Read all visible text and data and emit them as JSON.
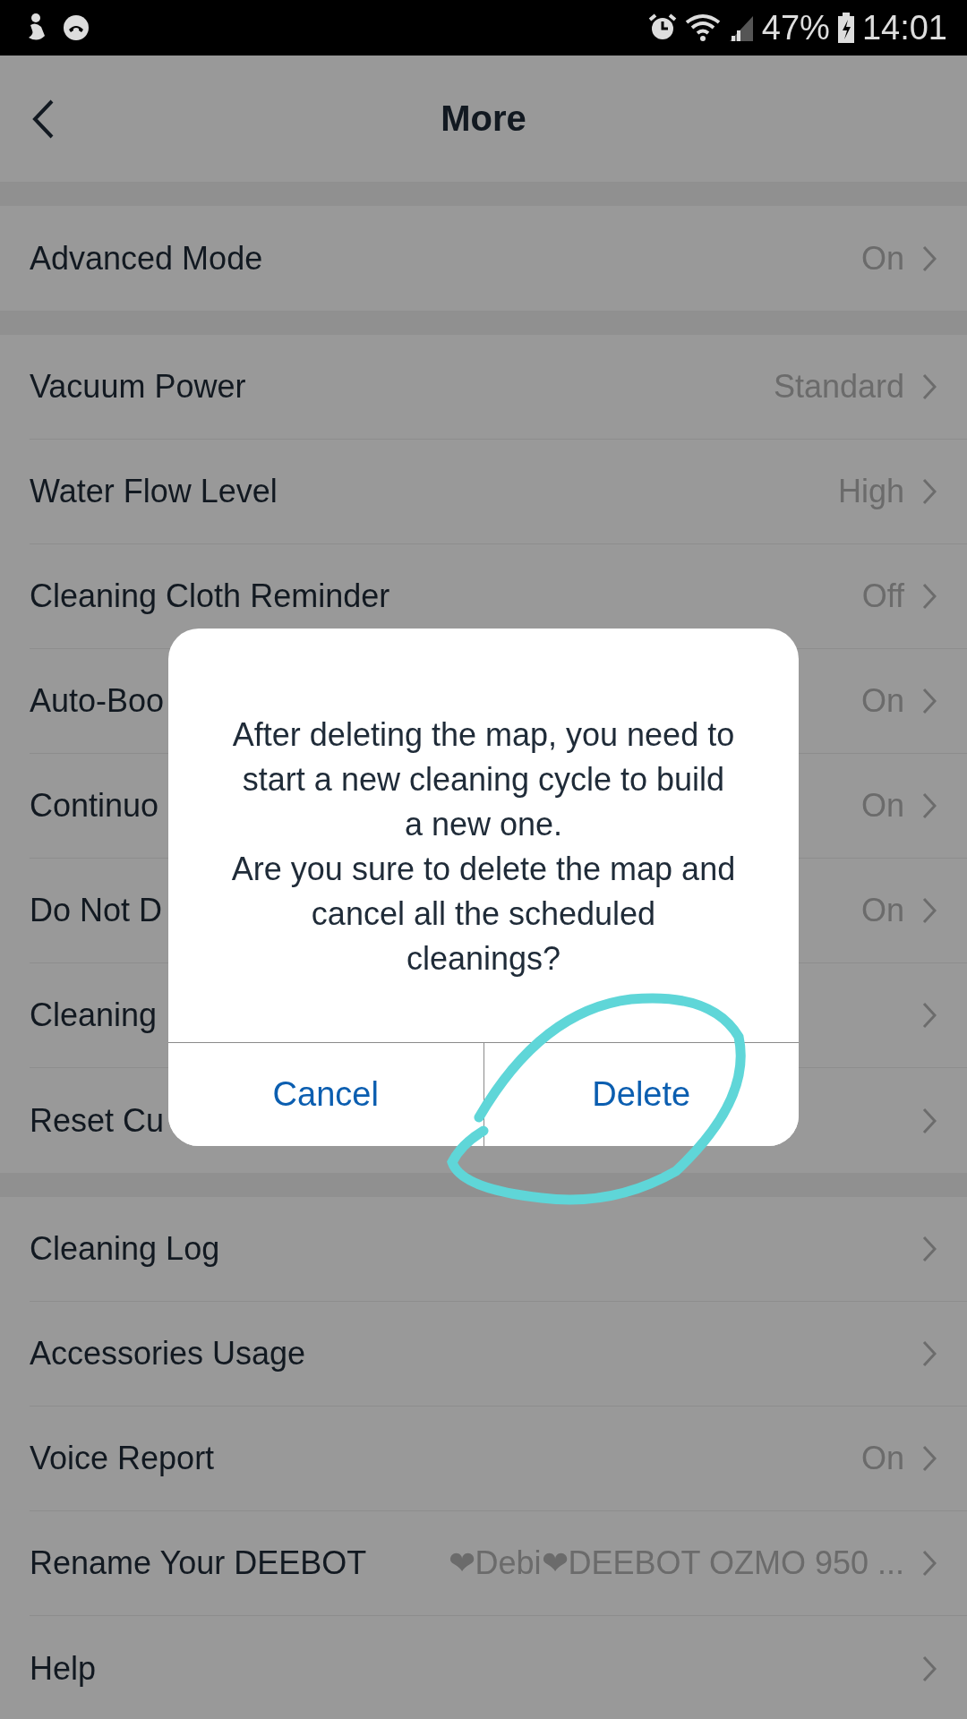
{
  "status_bar": {
    "battery": "47%",
    "time": "14:01"
  },
  "header": {
    "title": "More"
  },
  "sections": [
    {
      "rows": [
        {
          "label": "Advanced Mode",
          "value": "On"
        }
      ]
    },
    {
      "rows": [
        {
          "label": "Vacuum Power",
          "value": "Standard"
        },
        {
          "label": "Water Flow Level",
          "value": "High"
        },
        {
          "label": "Cleaning Cloth Reminder",
          "value": "Off"
        },
        {
          "label": "Auto-Boo",
          "value": "On"
        },
        {
          "label": "Continuo",
          "value": "On"
        },
        {
          "label": "Do Not D",
          "value": "On"
        },
        {
          "label": "Cleaning"
        },
        {
          "label": "Reset Cu"
        }
      ]
    },
    {
      "rows": [
        {
          "label": "Cleaning Log"
        },
        {
          "label": "Accessories Usage"
        },
        {
          "label": "Voice Report",
          "value": "On"
        },
        {
          "label": "Rename Your DEEBOT",
          "value": "❤Debi❤DEEBOT OZMO 950 ..."
        },
        {
          "label": "Help"
        }
      ]
    }
  ],
  "dialog": {
    "message": "After deleting the map, you need to start a new cleaning cycle to build a new one.\nAre you sure to delete the map and cancel all the scheduled cleanings?",
    "buttons": [
      {
        "label": "Cancel"
      },
      {
        "label": "Delete"
      }
    ]
  }
}
